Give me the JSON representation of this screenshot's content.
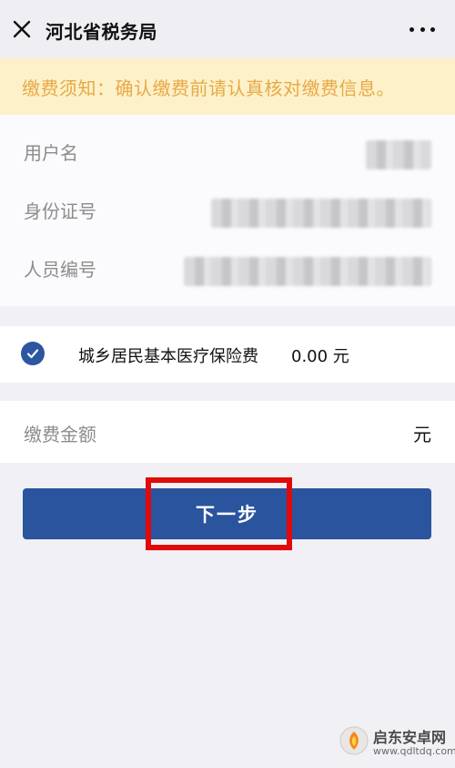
{
  "header": {
    "title": "河北省税务局",
    "close_icon": "close-icon",
    "more_icon": "more-horizontal-icon"
  },
  "notice": {
    "text": "缴费须知：确认缴费前请认真核对缴费信息。"
  },
  "info": {
    "rows": [
      {
        "label": "用户名"
      },
      {
        "label": "身份证号"
      },
      {
        "label": "人员编号"
      }
    ]
  },
  "fee": {
    "checked": true,
    "name": "城乡居民基本医疗保险费",
    "amount": "0.00 元"
  },
  "payment": {
    "label": "缴费金额",
    "unit": "元"
  },
  "next_button": {
    "label": "下一步"
  },
  "watermark": {
    "text": "启东安卓网",
    "url": "www.qdltdq.com"
  },
  "colors": {
    "accent": "#2a549e",
    "notice_bg": "#fdf1c9",
    "notice_text": "#e7a948",
    "highlight": "#e00a0a"
  }
}
